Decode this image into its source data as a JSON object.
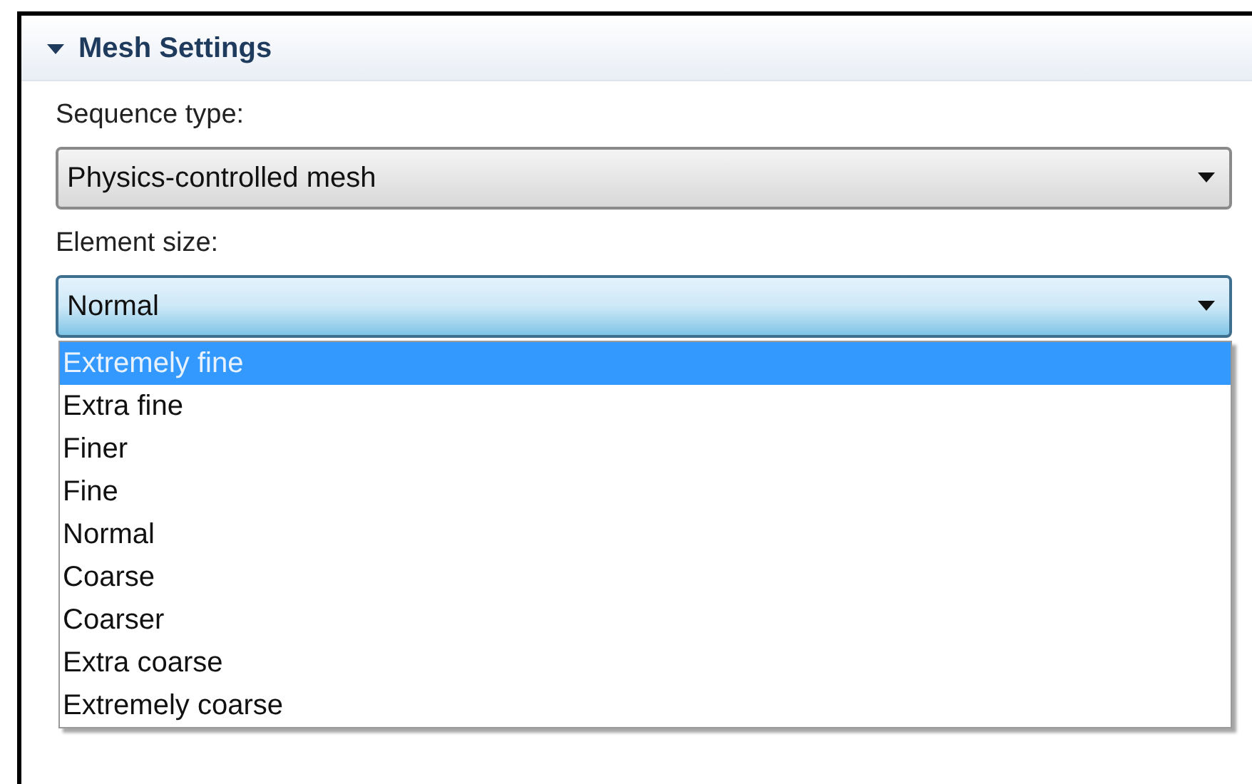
{
  "section": {
    "title": "Mesh Settings",
    "expanded": true
  },
  "fields": [
    {
      "label": "Sequence type:",
      "value": "Physics-controlled mesh",
      "open": false
    },
    {
      "label": "Element size:",
      "value": "Normal",
      "open": true,
      "options": [
        {
          "label": "Extremely fine",
          "highlighted": true
        },
        {
          "label": "Extra fine",
          "highlighted": false
        },
        {
          "label": "Finer",
          "highlighted": false
        },
        {
          "label": "Fine",
          "highlighted": false
        },
        {
          "label": "Normal",
          "highlighted": false
        },
        {
          "label": "Coarse",
          "highlighted": false
        },
        {
          "label": "Coarser",
          "highlighted": false
        },
        {
          "label": "Extra coarse",
          "highlighted": false
        },
        {
          "label": "Extremely coarse",
          "highlighted": false
        }
      ]
    }
  ]
}
